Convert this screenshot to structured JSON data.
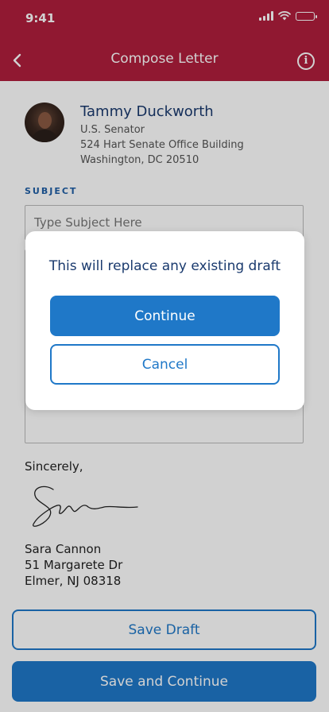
{
  "status_bar": {
    "time": "9:41",
    "icons": [
      "signal-icon",
      "wifi-icon",
      "battery-icon"
    ]
  },
  "nav": {
    "title": "Compose Letter",
    "back_icon": "chevron-left-icon",
    "info_icon": "info-icon",
    "info_glyph": "i"
  },
  "recipient": {
    "name": "Tammy Duckworth",
    "title": "U.S. Senator",
    "address_line1": "524 Hart Senate Office Building",
    "address_line2": "Washington, DC 20510"
  },
  "subject": {
    "label": "SUBJECT",
    "placeholder": "Type Subject Here",
    "value": ""
  },
  "letter": {
    "closing": "Sincerely,",
    "sender_name": "Sara Cannon",
    "sender_address1": "51 Margarete Dr",
    "sender_address2": "Elmer, NJ 08318"
  },
  "actions": {
    "save_draft": "Save Draft",
    "save_continue": "Save and Continue"
  },
  "modal": {
    "message": "This will replace any existing draft",
    "continue_label": "Continue",
    "cancel_label": "Cancel"
  },
  "colors": {
    "header": "#b01e3c",
    "primary": "#1f78c8",
    "heading_text": "#1a3a6e"
  }
}
